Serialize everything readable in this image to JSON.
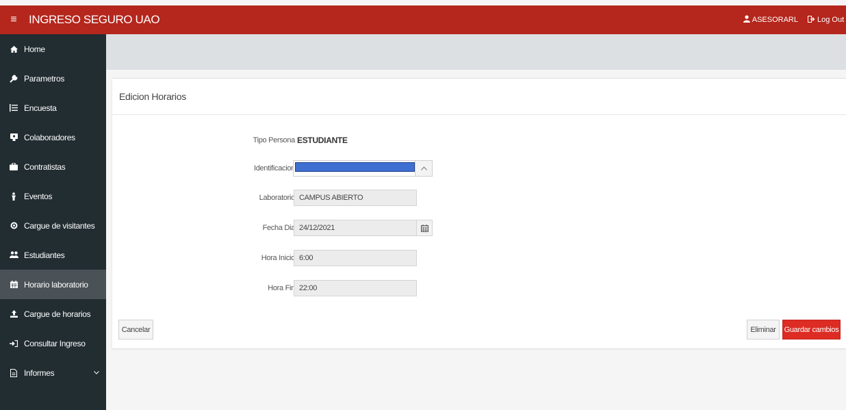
{
  "header": {
    "menu_icon": "hamburger-icon",
    "title": "INGRESO SEGURO UAO",
    "user": "ASESORARL",
    "logout": "Log Out",
    "bg_color": "#b5261c"
  },
  "sidebar": {
    "items": [
      {
        "label": "Home",
        "icon": "home-icon"
      },
      {
        "label": "Parametros",
        "icon": "wrench-icon"
      },
      {
        "label": "Encuesta",
        "icon": "list-icon"
      },
      {
        "label": "Colaboradores",
        "icon": "id-badge-icon"
      },
      {
        "label": "Contratistas",
        "icon": "briefcase-icon"
      },
      {
        "label": "Eventos",
        "icon": "event-icon"
      },
      {
        "label": "Cargue de visitantes",
        "icon": "target-icon"
      },
      {
        "label": "Estudiantes",
        "icon": "users-icon"
      },
      {
        "label": "Horario laboratorio",
        "icon": "calendar-icon",
        "active": true
      },
      {
        "label": "Cargue de horarios",
        "icon": "upload-icon"
      },
      {
        "label": "Consultar Ingreso",
        "icon": "sign-in-icon"
      },
      {
        "label": "Informes",
        "icon": "file-icon"
      }
    ],
    "bg_color": "#222d32"
  },
  "form": {
    "title": "Edicion Horarios",
    "tipo_persona": {
      "label": "Tipo Persona",
      "value": "ESTUDIANTE"
    },
    "identificacion": {
      "label": "Identificacion",
      "value": ""
    },
    "laboratorio": {
      "label": "Laboratorio",
      "value": "CAMPUS ABIERTO"
    },
    "fecha_dia": {
      "label": "Fecha Dia",
      "value": "24/12/2021"
    },
    "hora_inicio": {
      "label": "Hora Inicio",
      "value": "6:00"
    },
    "hora_fin": {
      "label": "Hora Fin",
      "value": "22:00"
    }
  },
  "buttons": {
    "cancel": "Cancelar",
    "delete": "Eliminar",
    "save": "Guardar cambios",
    "save_color": "#dd2c24"
  }
}
